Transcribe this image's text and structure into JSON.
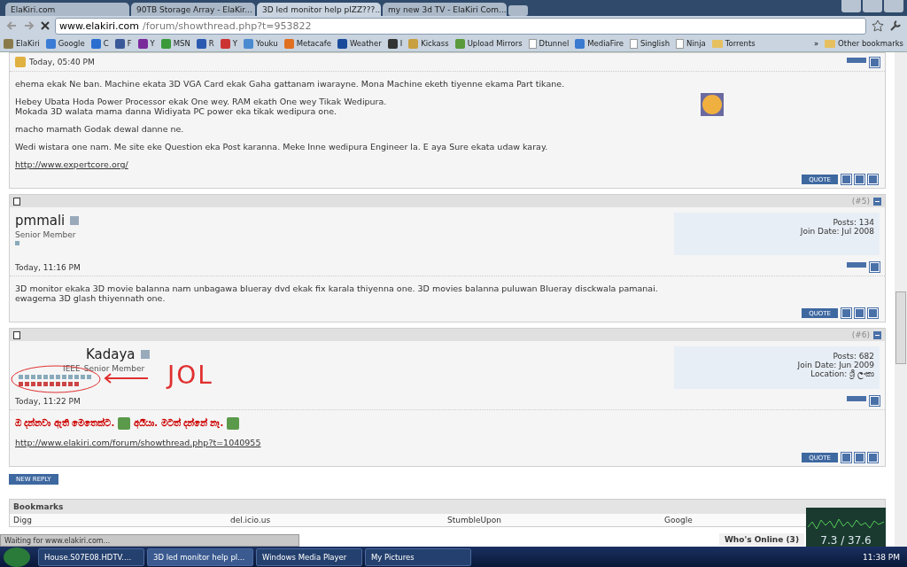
{
  "browser": {
    "tabs": [
      {
        "title": "ElaKiri.com",
        "selected": false
      },
      {
        "title": "90TB Storage Array - ElaKir...",
        "selected": false
      },
      {
        "title": "3D led monitor help plZZ???...",
        "selected": true
      },
      {
        "title": "my new 3d TV - ElaKiri Com...",
        "selected": false
      }
    ],
    "address": {
      "host": "www.elakiri.com",
      "path": "/forum/showthread.php?t=953822"
    },
    "bookmarks": [
      {
        "label": "ElaKiri",
        "kind": "site",
        "color": "#8a7a4a"
      },
      {
        "label": "Google",
        "kind": "site",
        "color": "#3a7bd5"
      },
      {
        "label": "C",
        "kind": "site",
        "color": "#2a6fd0"
      },
      {
        "label": "F",
        "kind": "site",
        "color": "#3b5998"
      },
      {
        "label": "Y",
        "kind": "site",
        "color": "#7b2a9b"
      },
      {
        "label": "MSN",
        "kind": "site",
        "color": "#3a9a3a"
      },
      {
        "label": "R",
        "kind": "site",
        "color": "#2a5ab0"
      },
      {
        "label": "Y",
        "kind": "site",
        "color": "#c33"
      },
      {
        "label": "Youku",
        "kind": "site",
        "color": "#4a8ad0"
      },
      {
        "label": "Metacafe",
        "kind": "site",
        "color": "#e07020"
      },
      {
        "label": "Weather",
        "kind": "site",
        "color": "#1a4a9a"
      },
      {
        "label": "I",
        "kind": "site",
        "color": "#333333"
      },
      {
        "label": "Kickass",
        "kind": "site",
        "color": "#c8a040"
      },
      {
        "label": "Upload Mirrors",
        "kind": "site",
        "color": "#5a9a3a"
      },
      {
        "label": "Dtunnel",
        "kind": "page"
      },
      {
        "label": "MediaFire",
        "kind": "site",
        "color": "#3a7ad0"
      },
      {
        "label": "Singlish",
        "kind": "page"
      },
      {
        "label": "Ninja",
        "kind": "page"
      },
      {
        "label": "Torrents",
        "kind": "folder"
      }
    ],
    "more": "»",
    "other": "Other bookmarks"
  },
  "posts": [
    {
      "date": "Today, 05:40 PM",
      "has_avatar": true,
      "paragraphs": [
        "ehema ekak Ne ban. Machine ekata 3D VGA Card ekak Gaha gattanam iwarayne. Mona Machine eketh tiyenne ekama Part tikane.",
        "Hebey Ubata Hoda Power Processor ekak One wey. RAM ekath One wey Tikak Wedipura.\nMokada 3D walata mama danna Widiyata PC power eka tikak wedipura one.",
        "macho mamath Godak dewal danne ne.",
        "Wedi wistara one nam. Me site eke Question eka Post karanna. Meke Inne wedipura Engineer la. E aya Sure ekata udaw karay."
      ],
      "link": "http://www.expertcore.org/",
      "quote": "QUOTE"
    },
    {
      "number": "(#5)",
      "user": "pmmali",
      "title": "Senior Member",
      "stats": [
        "Posts: 134",
        "Join Date: Jul 2008"
      ],
      "reputation": {
        "kind": "single"
      },
      "date": "Today, 11:16 PM",
      "paragraphs": [
        "3D monitor ekaka 3D movie balanna nam unbagawa blueray dvd ekak fix karala thiyenna one. 3D movies balanna puluwan Blueray disckwala pamanai.\newagema 3D glash thiyennath one."
      ],
      "quote": "QUOTE"
    },
    {
      "number": "(#6)",
      "user": "Kadaya",
      "prefix": "IEEE",
      "title": "Senior Member",
      "stats": [
        "Posts: 682",
        "Join Date: Jun 2009",
        "Location: ශ්‍රී ලංකා"
      ],
      "reputation": {
        "kind": "double"
      },
      "annotated": true,
      "date": "Today, 11:22 PM",
      "sinhala": [
        "ඔ දන්නවා ඇති මෙතෙක්ට.",
        "අයියා. මටත් දන්නේ නෑ."
      ],
      "link": "http://www.elakiri.com/forum/showthread.php?t=1040955",
      "quote": "QUOTE"
    }
  ],
  "annotation_text": "JOL",
  "new_reply": "NEW REPLY",
  "social": {
    "title": "Bookmarks",
    "items": [
      "Digg",
      "del.icio.us",
      "StumbleUpon",
      "Google"
    ]
  },
  "status": "Waiting for www.elakiri.com...",
  "whos_online": "Who's Online (3)",
  "meter": "7.3 / 37.6",
  "taskbar": {
    "tasks": [
      {
        "label": "House.S07E08.HDTV....",
        "selected": false
      },
      {
        "label": "3D led monitor help pl...",
        "selected": true
      },
      {
        "label": "Windows Media Player",
        "selected": false
      },
      {
        "label": "My Pictures",
        "selected": false
      }
    ],
    "clock": "11:38 PM"
  }
}
